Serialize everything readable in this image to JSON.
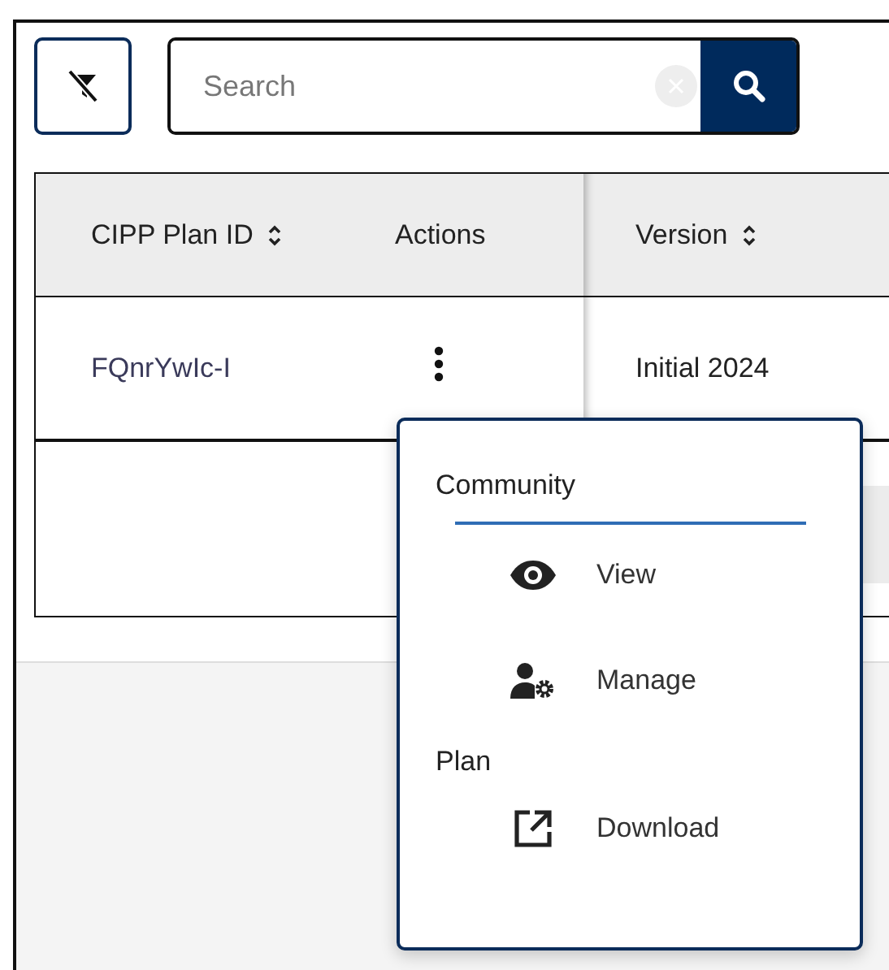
{
  "toolbar": {
    "search": {
      "placeholder": "Search"
    }
  },
  "table": {
    "columns": [
      {
        "label": "CIPP Plan ID",
        "sortable": true
      },
      {
        "label": "Actions",
        "sortable": false
      },
      {
        "label": "Version",
        "sortable": true
      }
    ],
    "rows": [
      {
        "cells": [
          "FQnrYwIc-I",
          "",
          "Initial 2024"
        ]
      }
    ]
  },
  "menu": {
    "groups": [
      {
        "label": "Community",
        "focused": true,
        "items": [
          {
            "label": "View"
          },
          {
            "label": "Manage"
          }
        ]
      },
      {
        "label": "Plan",
        "focused": false,
        "items": [
          {
            "label": "Download"
          }
        ]
      }
    ]
  }
}
